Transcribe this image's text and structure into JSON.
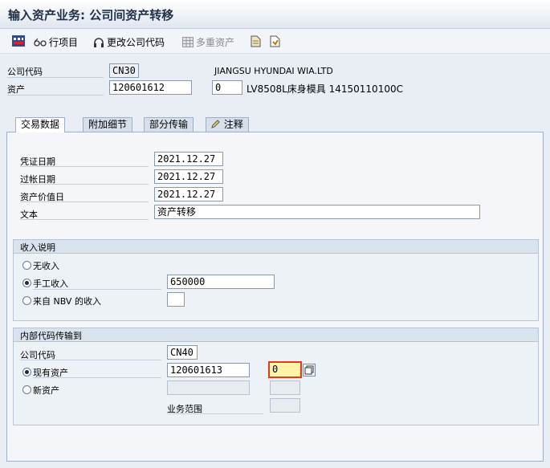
{
  "title": "输入资产业务: 公司间资产转移",
  "toolbar": {
    "items": [
      {
        "label": "",
        "icon": "overview-icon"
      },
      {
        "label": "行项目",
        "icon": "glasses-icon"
      },
      {
        "label": "更改公司代码",
        "icon": "headphones-icon"
      },
      {
        "label": "多重资产",
        "icon": "grid-icon"
      },
      {
        "label": "",
        "icon": "document-icon"
      },
      {
        "label": "",
        "icon": "save-doc-icon"
      }
    ]
  },
  "header": {
    "company_code_label": "公司代码",
    "company_code_value": "CN30",
    "company_name": "JIANGSU HYUNDAI WIA.LTD",
    "asset_label": "资产",
    "asset_value": "120601612",
    "subnumber": "0",
    "asset_desc": "LV8508L床身模具 14150110100C"
  },
  "tabs": [
    {
      "label": "交易数据",
      "active": true
    },
    {
      "label": "附加细节",
      "active": false
    },
    {
      "label": "部分传输",
      "active": false
    },
    {
      "label": "注释",
      "active": false
    }
  ],
  "transaction": {
    "doc_date_label": "凭证日期",
    "doc_date": "2021.12.27",
    "post_date_label": "过帐日期",
    "post_date": "2021.12.27",
    "value_date_label": "资产价值日",
    "value_date": "2021.12.27",
    "text_label": "文本",
    "text": "资产转移"
  },
  "revenue": {
    "title": "收入说明",
    "opt1": "无收入",
    "opt2": "手工收入",
    "opt2_value": "650000",
    "opt3": "来自 NBV 的收入",
    "selected": "manual"
  },
  "transfer": {
    "title": "内部代码传输到",
    "company_code_label": "公司代码",
    "company_code_value": "CN40",
    "existing_asset_label": "现有资产",
    "existing_asset_value": "120601613",
    "existing_sub_value": "0",
    "new_asset_label": "新资产",
    "business_area_label": "业务范围",
    "selected": "existing"
  }
}
